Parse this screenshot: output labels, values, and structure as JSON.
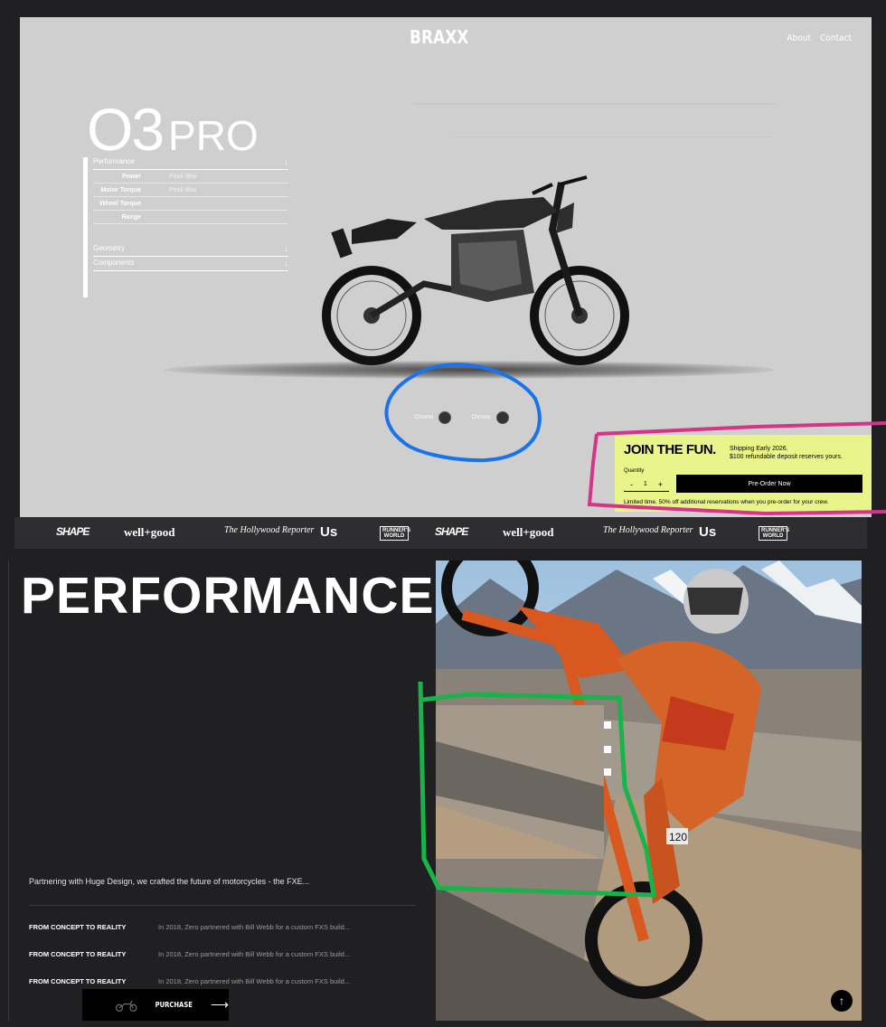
{
  "header": {
    "brand": "BRAXX",
    "nav": [
      "About",
      "Contact"
    ]
  },
  "hero": {
    "model_number": "O3",
    "model_suffix": "PRO",
    "specs": {
      "sections": [
        "Performance",
        "Geometry",
        "Components"
      ],
      "rows": [
        {
          "label": "Power",
          "value": "Peak 8kw"
        },
        {
          "label": "Motor Torque",
          "value": "Peak 8kw"
        },
        {
          "label": "Wheel Torque",
          "value": ""
        },
        {
          "label": "Range",
          "value": ""
        }
      ]
    },
    "color_options": [
      {
        "label": "Chrome",
        "color": "#333333"
      },
      {
        "label": "Chrome",
        "color": "#333333"
      }
    ]
  },
  "join": {
    "title": "JOIN THE FUN.",
    "shipping_line1": "Shipping Early 2026.",
    "shipping_line2": "$100 refundable deposit reserves yours.",
    "quantity_label": "Quantity",
    "quantity_minus": "-",
    "quantity_value": "1",
    "quantity_plus": "+",
    "cta": "Pre-Order Now",
    "note": "Limited time. 50% off additional reservations when you pre-order for your crew."
  },
  "press_logos": [
    "SHAPE",
    "well+good",
    "The Hollywood Reporter",
    "Us",
    "RUNNER'S WORLD",
    "SHAPE",
    "well+good",
    "The Hollywood Reporter",
    "Us",
    "RUNNER'S WORLD"
  ],
  "performance": {
    "title": "PERFORMANCE",
    "intro": "Partnering with Huge Design, we crafted the future of motorcycles - the FXE...",
    "rows": [
      {
        "key": "FROM CONCEPT TO REALITY",
        "value": "In 2018, Zero partnered with Bill Webb for a custom FXS build..."
      },
      {
        "key": "FROM CONCEPT TO REALITY",
        "value": "In 2018, Zero partnered with Bill Webb for a custom FXS build..."
      },
      {
        "key": "FROM CONCEPT TO REALITY",
        "value": "In 2018, Zero partnered with Bill Webb for a custom FXS build..."
      }
    ],
    "purchase_label": "PURCHASE",
    "purchase_arrow": "⟶",
    "scroll_top": "↑",
    "rider_number": "120"
  },
  "colors": {
    "hero_bg": "#cfcfcf",
    "page_bg": "#202022",
    "join_bg": "#e9f58a",
    "annotation_blue": "#1a73e8",
    "annotation_pink": "#d6338a",
    "annotation_green": "#19b34a"
  }
}
